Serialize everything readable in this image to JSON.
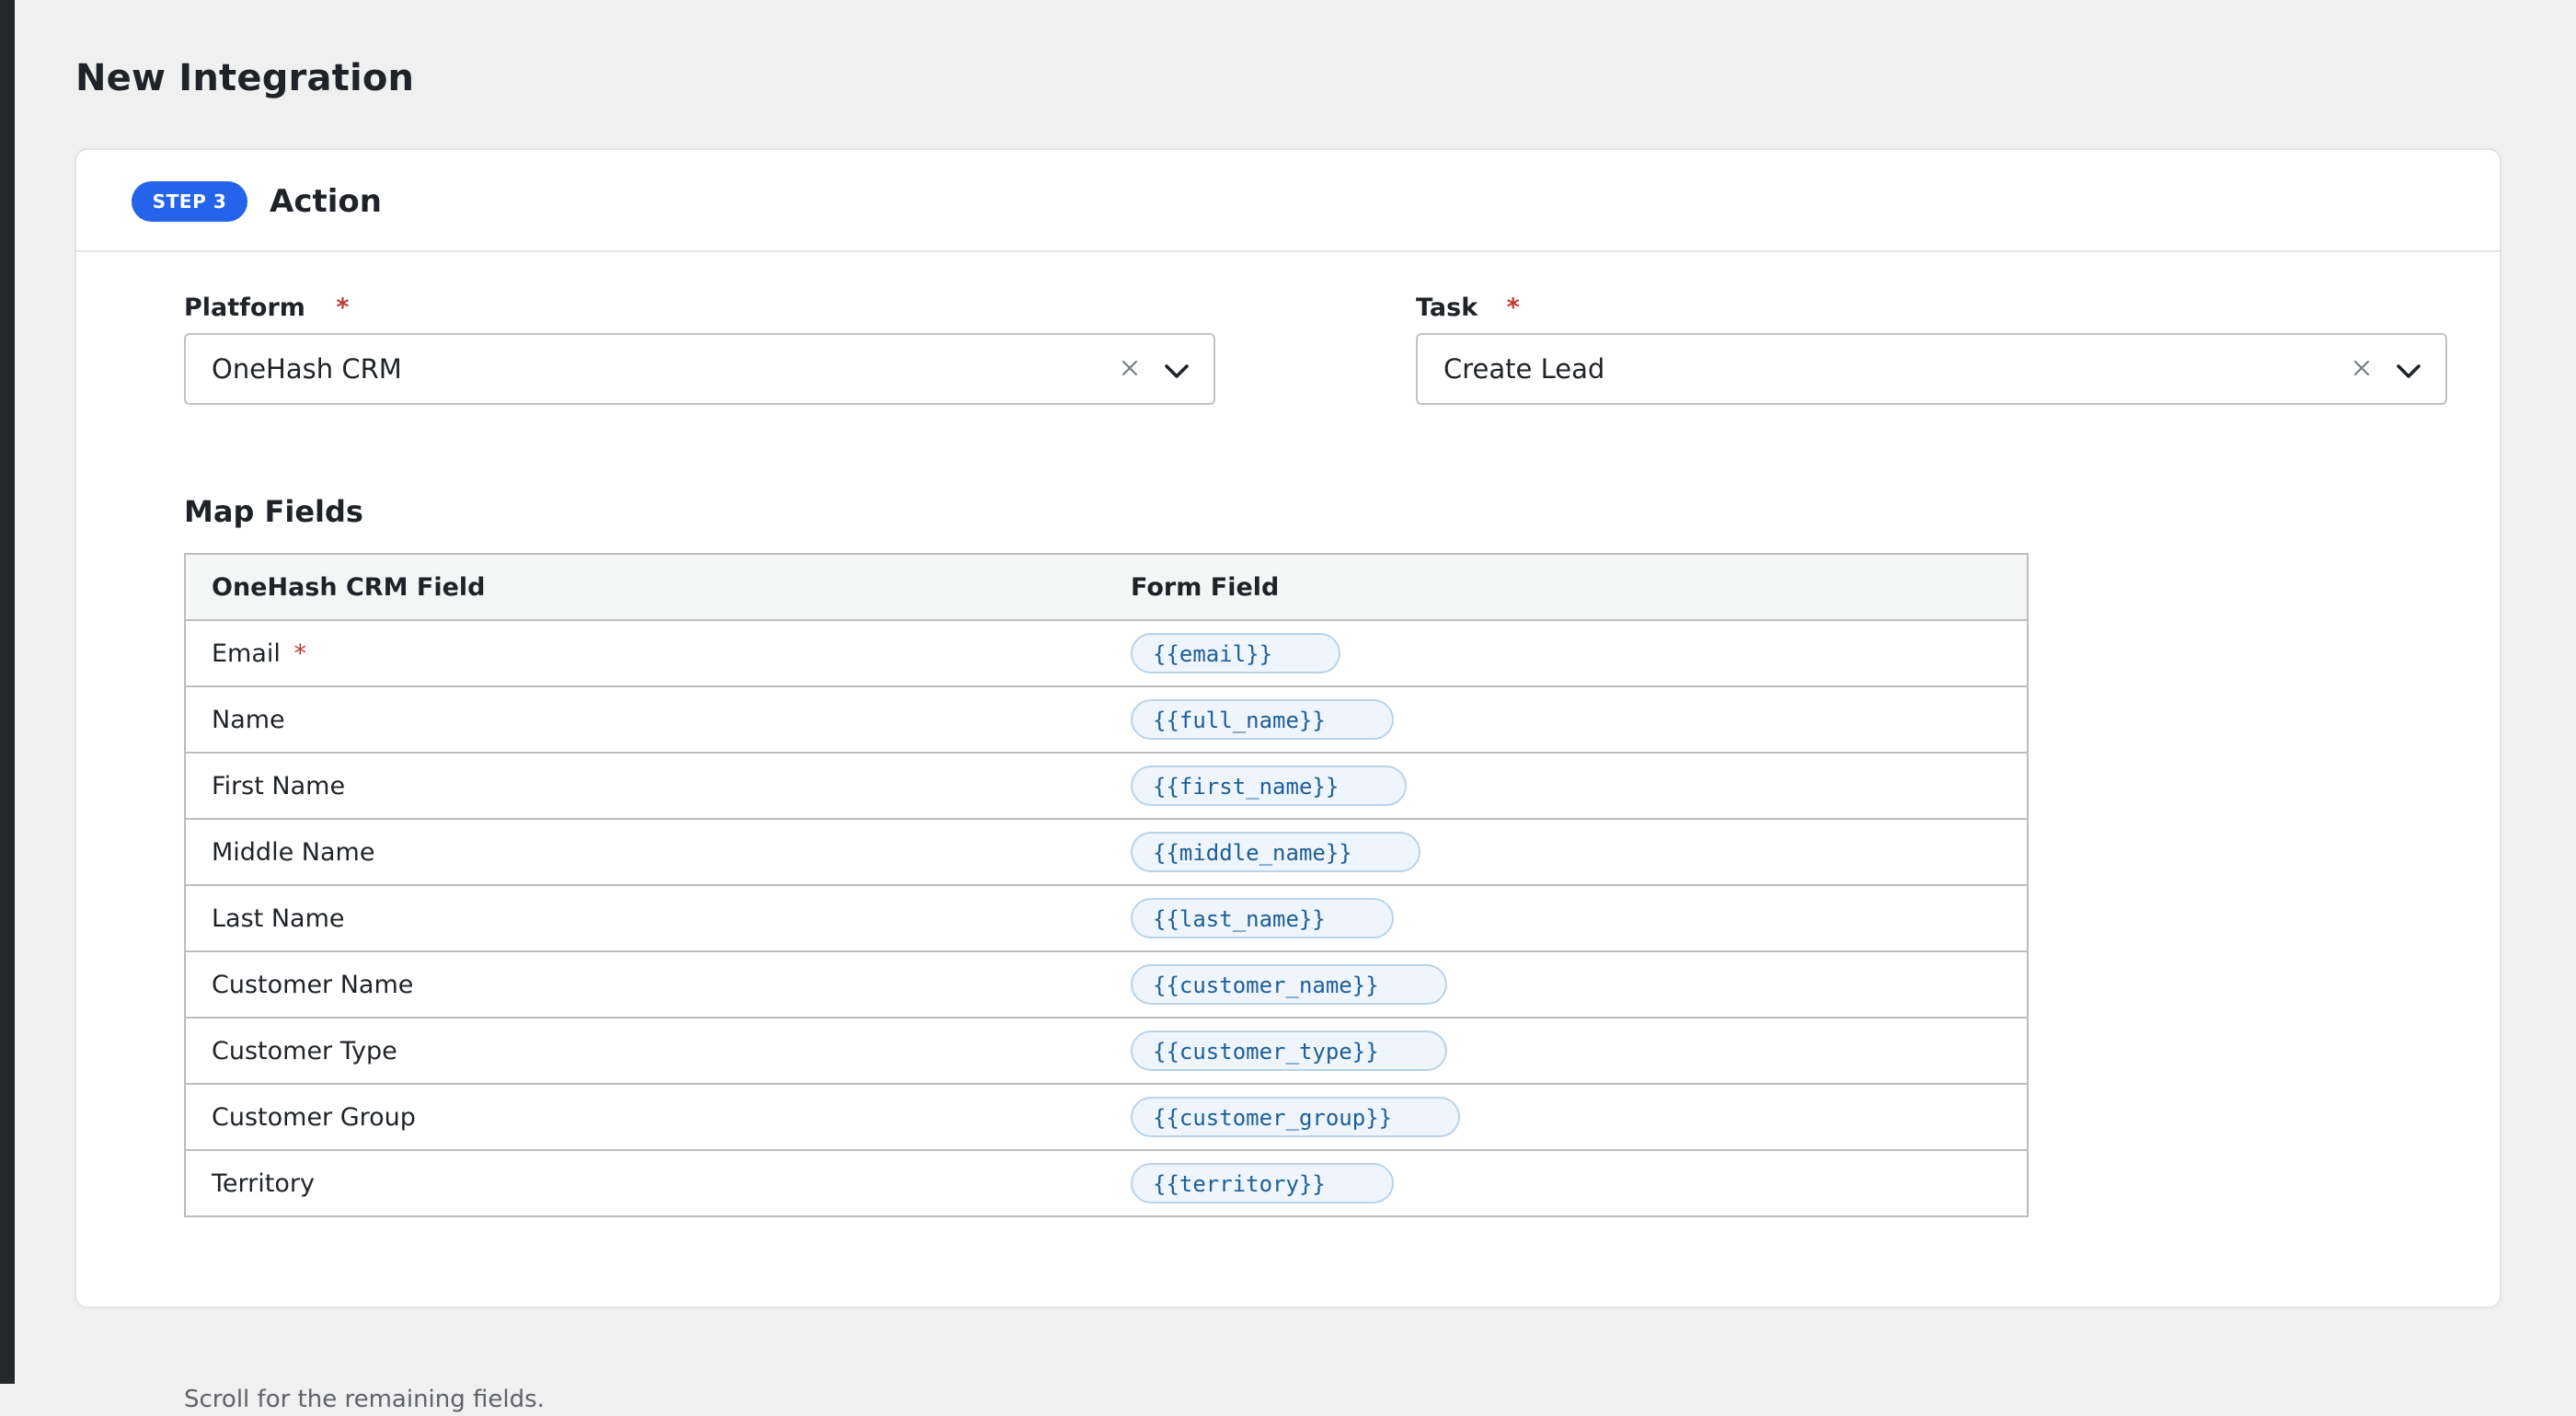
{
  "page": {
    "title": "New Integration"
  },
  "step": {
    "badge": "STEP 3",
    "title": "Action"
  },
  "platform": {
    "label": "Platform",
    "required_marker": "*",
    "value": "OneHash CRM"
  },
  "task": {
    "label": "Task",
    "required_marker": "*",
    "value": "Create Lead"
  },
  "map_fields": {
    "title": "Map Fields",
    "headers": [
      "OneHash CRM Field",
      "Form Field"
    ],
    "rows": [
      {
        "crm_field": "Email",
        "required": "*",
        "form_field": "{{email}}"
      },
      {
        "crm_field": "Name",
        "form_field": "{{full_name}}"
      },
      {
        "crm_field": "First Name",
        "form_field": "{{first_name}}"
      },
      {
        "crm_field": "Middle Name",
        "form_field": "{{middle_name}}"
      },
      {
        "crm_field": "Last Name",
        "form_field": "{{last_name}}"
      },
      {
        "crm_field": "Customer Name",
        "form_field": "{{customer_name}}"
      },
      {
        "crm_field": "Customer Type",
        "form_field": "{{customer_type}}"
      },
      {
        "crm_field": "Customer Group",
        "form_field": "{{customer_group}}"
      },
      {
        "crm_field": "Territory",
        "form_field": "{{territory}}"
      }
    ],
    "helper_text": "Scroll for the remaining fields."
  },
  "colors": {
    "accent": "#2563eb",
    "required": "#c0392b",
    "token_text": "#1f5e99",
    "token_bg": "#eef5fc"
  },
  "icons": {
    "clear": "close-icon",
    "expand": "chevron-down-icon"
  }
}
